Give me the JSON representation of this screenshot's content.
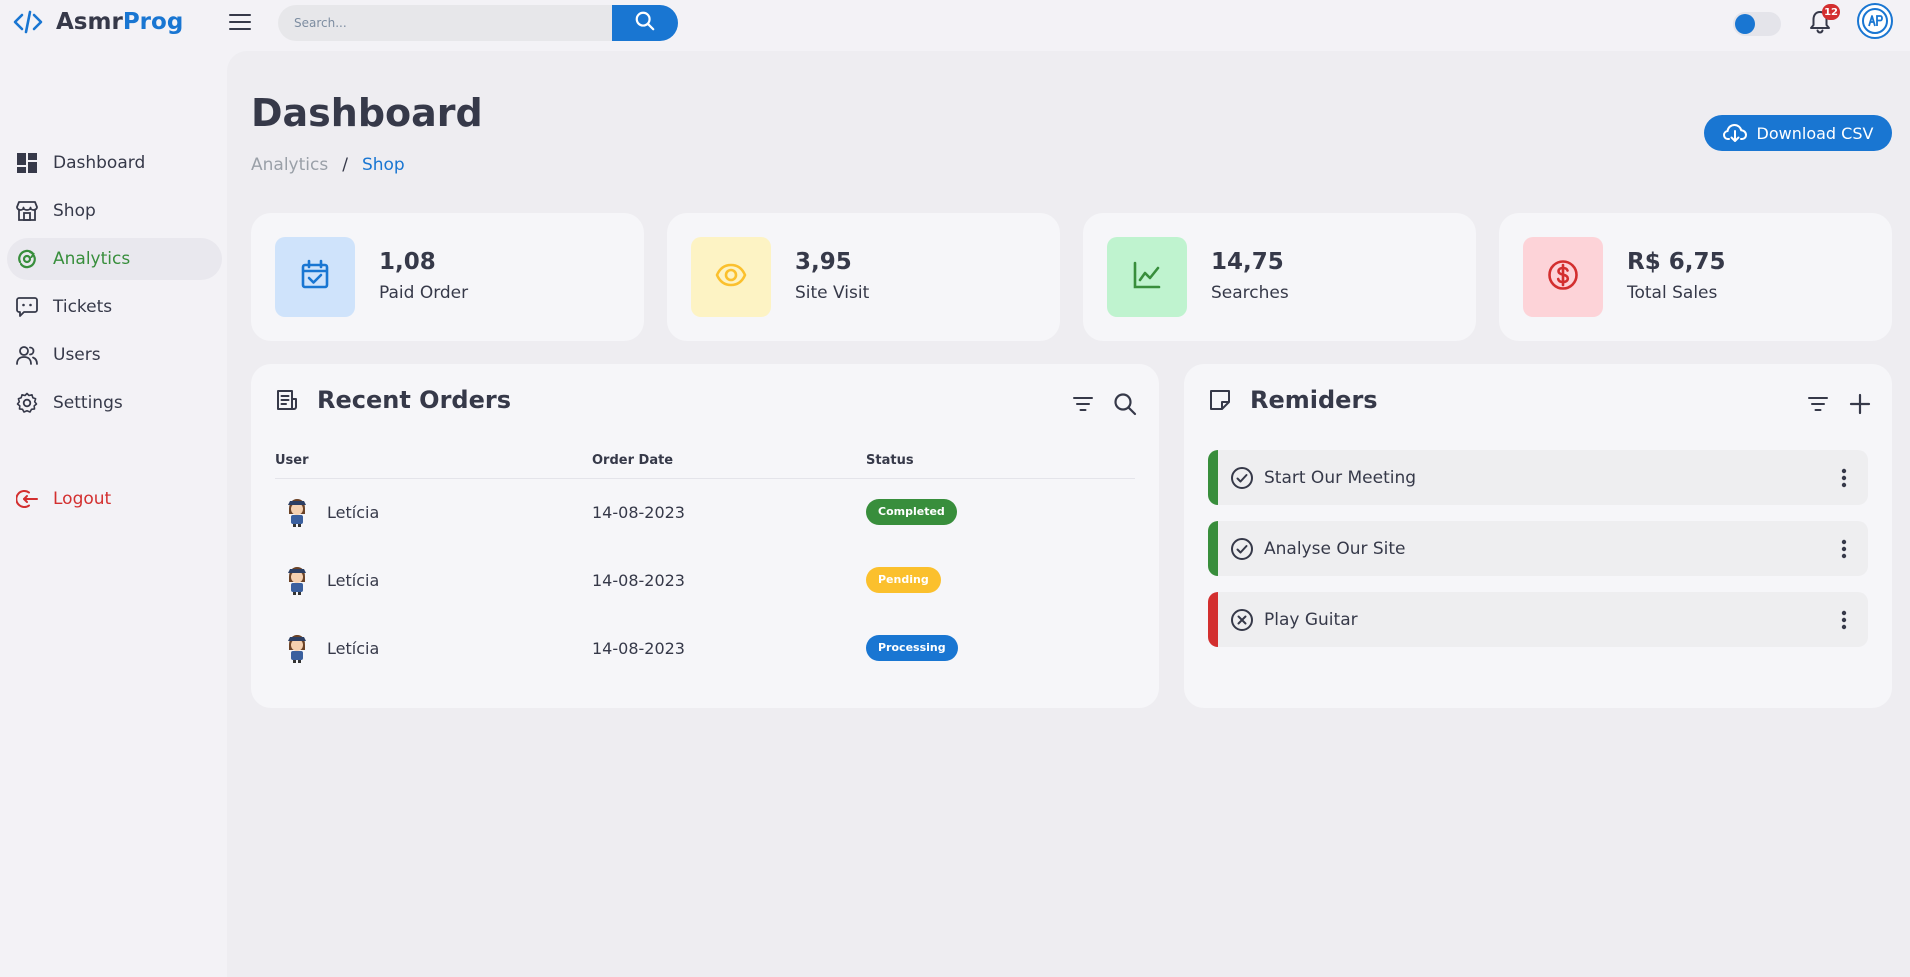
{
  "brand": {
    "part1": "Asmr",
    "part2": "Prog",
    "accent": "#1976d2"
  },
  "search": {
    "placeholder": "Search..."
  },
  "notifications": {
    "count": "12"
  },
  "sidebar": {
    "items": [
      {
        "label": "Dashboard",
        "icon": "dashboard-icon"
      },
      {
        "label": "Shop",
        "icon": "store-icon"
      },
      {
        "label": "Analytics",
        "icon": "analytics-icon",
        "active": true
      },
      {
        "label": "Tickets",
        "icon": "ticket-icon"
      },
      {
        "label": "Users",
        "icon": "users-icon"
      },
      {
        "label": "Settings",
        "icon": "settings-icon"
      }
    ],
    "logout": "Logout"
  },
  "header": {
    "title": "Dashboard",
    "breadcrumb": [
      "Analytics",
      "Shop"
    ],
    "download_label": "Download CSV"
  },
  "insights": [
    {
      "value": "1,08",
      "label": "Paid Order",
      "icon": "calendar-check-icon",
      "color": "#1976d2",
      "bg": "#cfe3fb"
    },
    {
      "value": "3,95",
      "label": "Site Visit",
      "icon": "eye-icon",
      "color": "#fbc02d",
      "bg": "#fdf3c4"
    },
    {
      "value": "14,75",
      "label": "Searches",
      "icon": "line-chart-icon",
      "color": "#388e3c",
      "bg": "#bff3cf"
    },
    {
      "value": "R$ 6,75",
      "label": "Total Sales",
      "icon": "dollar-icon",
      "color": "#d32f2f",
      "bg": "#fdd3d8"
    }
  ],
  "orders": {
    "title": "Recent Orders",
    "columns": [
      "User",
      "Order Date",
      "Status"
    ],
    "rows": [
      {
        "user": "Letícia",
        "date": "14-08-2023",
        "status": "Completed"
      },
      {
        "user": "Letícia",
        "date": "14-08-2023",
        "status": "Pending"
      },
      {
        "user": "Letícia",
        "date": "14-08-2023",
        "status": "Processing"
      }
    ]
  },
  "reminders": {
    "title": "Remiders",
    "tasks": [
      {
        "label": "Start Our Meeting",
        "done": true,
        "color": "#388e3c"
      },
      {
        "label": "Analyse Our Site",
        "done": true,
        "color": "#388e3c"
      },
      {
        "label": "Play Guitar",
        "done": false,
        "color": "#d32f2f"
      }
    ]
  }
}
